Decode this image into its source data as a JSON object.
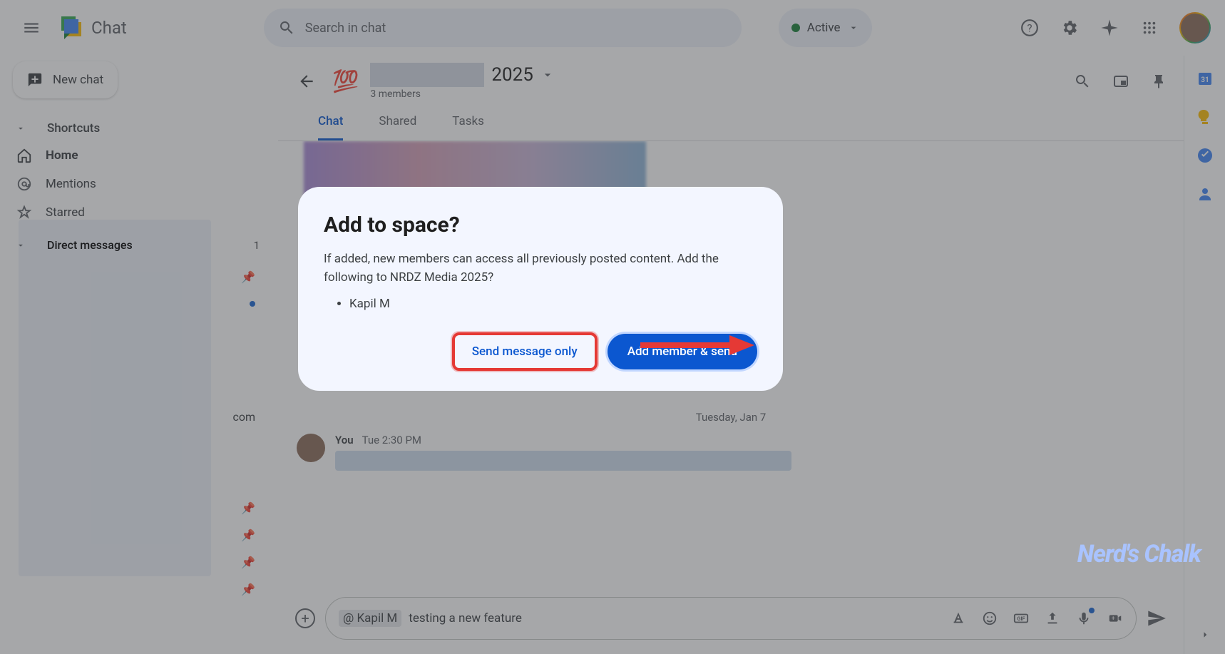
{
  "header": {
    "app_name": "Chat",
    "search_placeholder": "Search in chat",
    "status_label": "Active"
  },
  "sidebar": {
    "new_chat": "New chat",
    "sections": {
      "shortcuts": "Shortcuts",
      "home": "Home",
      "mentions": "Mentions",
      "starred": "Starred",
      "direct_messages": "Direct messages",
      "dm_count": "1"
    },
    "visible_text": "com"
  },
  "space": {
    "year": "2025",
    "members": "3 members",
    "tabs": {
      "chat": "Chat",
      "shared": "Shared",
      "tasks": "Tasks"
    }
  },
  "chat": {
    "date_divider": "Tuesday, Jan 7",
    "msg_author": "You",
    "msg_time": "Tue 2:30 PM"
  },
  "composer": {
    "mention": "@ Kapil M",
    "text": "testing a new feature"
  },
  "modal": {
    "title": "Add to space?",
    "description": "If added, new members can access all previously posted content. Add the following to NRDZ Media 2025?",
    "member": "Kapil M",
    "btn_send_only": "Send message only",
    "btn_add_send": "Add member & send"
  },
  "watermark": "Nerd's Chalk"
}
